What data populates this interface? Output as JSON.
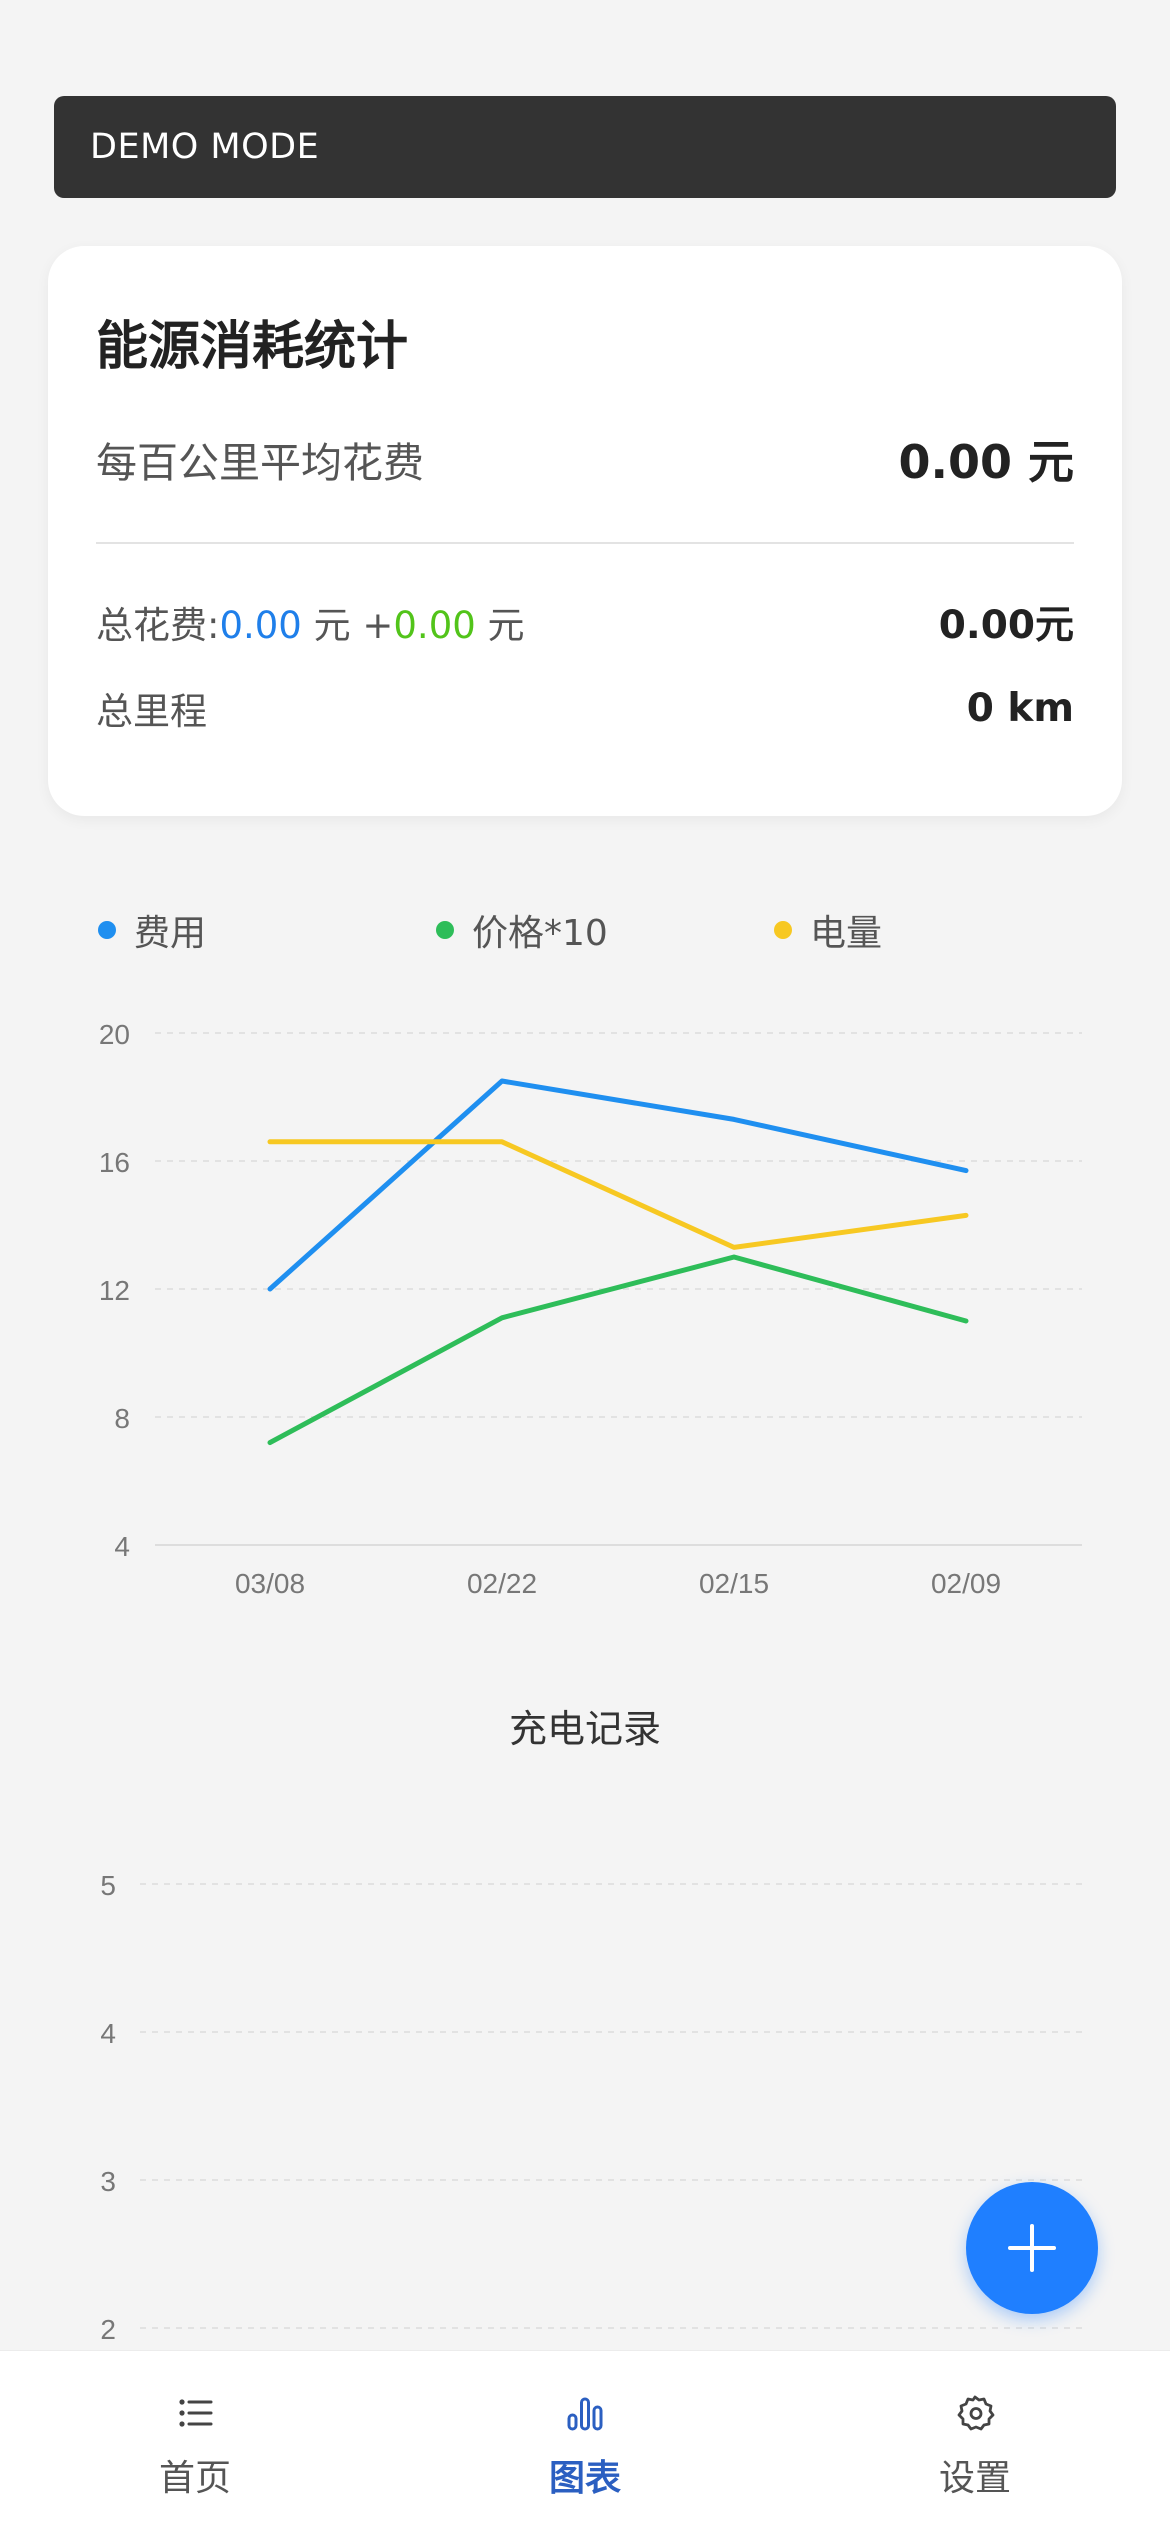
{
  "banner": {
    "text": "DEMO MODE"
  },
  "stats": {
    "title": "能源消耗统计",
    "avg_label": "每百公里平均花费",
    "avg_value": "0.00 元",
    "total_label": "总花费:",
    "total_part1": "0.00",
    "total_unit1": " 元 +",
    "total_part2": "0.00",
    "total_unit2": " 元",
    "total_value": "0.00元",
    "mileage_label": "总里程",
    "mileage_value": "0 km"
  },
  "colors": {
    "cost": "#1f8ff0",
    "price": "#2ebd59",
    "energy": "#f7c822",
    "accent": "#1f7fff",
    "tab_active": "#2b5fc1"
  },
  "chart_data": [
    {
      "type": "line",
      "categories": [
        "03/08",
        "02/22",
        "02/15",
        "02/09"
      ],
      "series": [
        {
          "name": "费用",
          "values": [
            12.0,
            18.5,
            17.3,
            15.7
          ]
        },
        {
          "name": "价格*10",
          "values": [
            7.2,
            11.1,
            13.0,
            11.0
          ]
        },
        {
          "name": "电量",
          "values": [
            16.6,
            16.6,
            13.3,
            14.3
          ]
        }
      ],
      "y_ticks": [
        "4",
        "8",
        "12",
        "16",
        "20"
      ],
      "ylim": [
        4,
        20
      ],
      "legend_position": "top",
      "grid": true
    },
    {
      "type": "line",
      "title": "充电记录",
      "categories": [],
      "series": [],
      "y_ticks": [
        "2",
        "3",
        "4",
        "5"
      ],
      "grid": true
    }
  ],
  "fab": {
    "icon": "plus-icon"
  },
  "tabs": [
    {
      "label": "首页",
      "icon": "list-icon",
      "active": false
    },
    {
      "label": "图表",
      "icon": "bar-chart-icon",
      "active": true
    },
    {
      "label": "设置",
      "icon": "gear-icon",
      "active": false
    }
  ]
}
